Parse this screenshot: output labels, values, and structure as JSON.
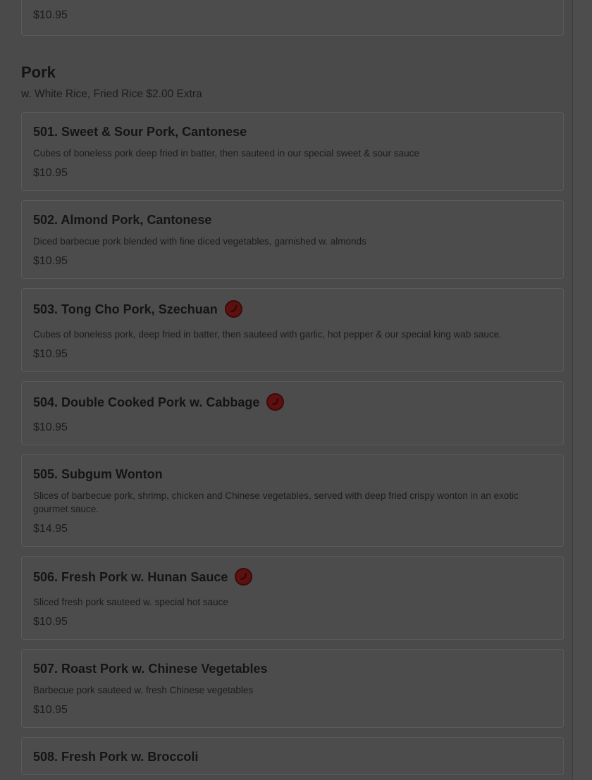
{
  "previous_item": {
    "price": "$10.95"
  },
  "section": {
    "title": "Pork",
    "subtitle": "w. White Rice, Fried Rice $2.00 Extra"
  },
  "spicy_icon": "chili-pepper-icon",
  "colors": {
    "spicy_badge": "#5c1010",
    "overlay": "#4a4a4a"
  },
  "items": [
    {
      "title": "501. Sweet & Sour Pork, Cantonese",
      "desc": "Cubes of boneless pork deep fried in batter, then sauteed in our special sweet & sour sauce",
      "price": "$10.95",
      "spicy": false
    },
    {
      "title": "502. Almond Pork, Cantonese",
      "desc": "Diced barbecue pork blended with fine diced vegetables, garnished w. almonds",
      "price": "$10.95",
      "spicy": false
    },
    {
      "title": "503. Tong Cho Pork, Szechuan",
      "desc": "Cubes of boneless pork, deep fried in batter, then sauteed with garlic, hot pepper & our special king wab sauce.",
      "price": "$10.95",
      "spicy": true
    },
    {
      "title": "504. Double Cooked Pork w. Cabbage",
      "desc": "",
      "price": "$10.95",
      "spicy": true
    },
    {
      "title": "505. Subgum Wonton",
      "desc": "Slices of barbecue pork, shrimp, chicken and Chinese vegetables, served with deep fried crispy wonton in an exotic gourmet sauce.",
      "price": "$14.95",
      "spicy": false
    },
    {
      "title": "506. Fresh Pork w. Hunan Sauce",
      "desc": "Sliced fresh pork sauteed w. special hot sauce",
      "price": "$10.95",
      "spicy": true
    },
    {
      "title": "507. Roast Pork w. Chinese Vegetables",
      "desc": "Barbecue pork sauteed w. fresh Chinese vegetables",
      "price": "$10.95",
      "spicy": false
    },
    {
      "title": "508. Fresh Pork w. Broccoli",
      "desc": "",
      "price": "",
      "spicy": false
    }
  ]
}
